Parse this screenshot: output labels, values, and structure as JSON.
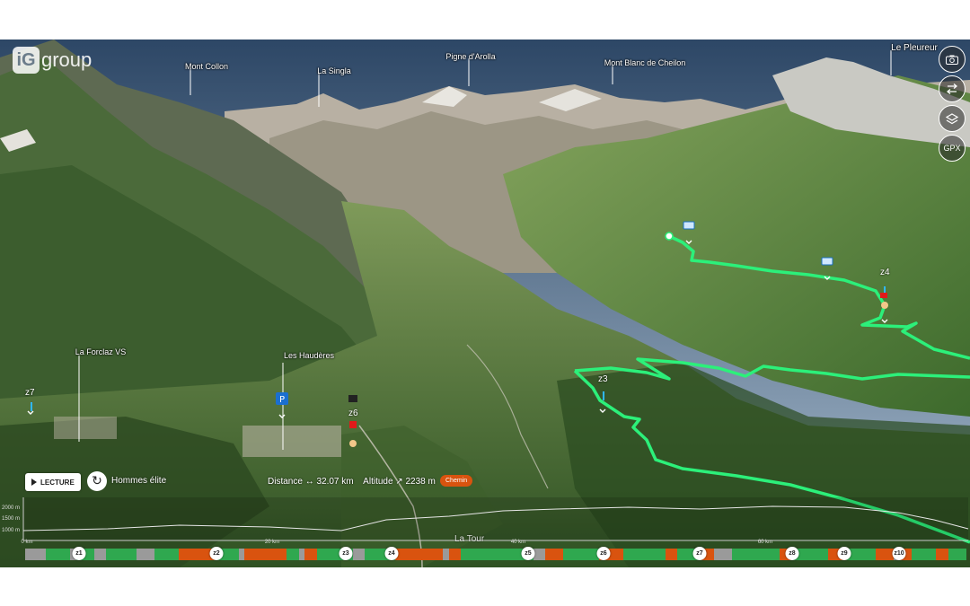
{
  "logo": {
    "mark": "iG",
    "text": "group"
  },
  "peaks": [
    {
      "label": "Mont Collon"
    },
    {
      "label": "La Singla"
    },
    {
      "label": "Pigne d'Arolla"
    },
    {
      "label": "Mont Blanc de Cheilon"
    },
    {
      "label": "Le Pleureur"
    }
  ],
  "places": [
    {
      "label": "La Forclaz VS"
    },
    {
      "label": "Les Haudères"
    }
  ],
  "zones_on_map": [
    "z7",
    "z6",
    "z3",
    "z4"
  ],
  "side_buttons": [
    {
      "name": "camera-icon",
      "text": ""
    },
    {
      "name": "swap-icon",
      "text": ""
    },
    {
      "name": "layers-icon",
      "text": ""
    },
    {
      "name": "gpx",
      "text": "GPX"
    }
  ],
  "player": {
    "lecture_label": "LECTURE",
    "category": "Hommes élite",
    "distance_label": "Distance",
    "distance_icon": "↔",
    "distance_value": "32.07 km",
    "altitude_label": "Altitude",
    "altitude_icon": "↗",
    "altitude_value": "2238 m",
    "surface_badge": "Chemin"
  },
  "profile": {
    "alt_ticks": [
      "2000 m",
      "1500 m",
      "1000 m"
    ],
    "km_ticks": [
      "0 km",
      "20 km",
      "40 km",
      "60 km"
    ],
    "location_label": "La Tour"
  },
  "zonebar": {
    "colors": {
      "grass": "#2fa84f",
      "path": "#d9530f",
      "road": "#9a9a9a"
    },
    "segments": [
      [
        "road",
        3.5
      ],
      [
        "grass",
        4
      ],
      [
        "road",
        1
      ],
      [
        "grass",
        3
      ],
      [
        "road",
        2
      ],
      [
        "grass",
        5
      ],
      [
        "road",
        3
      ],
      [
        "grass",
        4
      ],
      [
        "path",
        6
      ],
      [
        "grass",
        4
      ],
      [
        "road",
        1
      ],
      [
        "path",
        7
      ],
      [
        "grass",
        2
      ],
      [
        "road",
        1
      ],
      [
        "path",
        2
      ],
      [
        "grass",
        6
      ],
      [
        "road",
        2
      ],
      [
        "grass",
        5
      ],
      [
        "path",
        8
      ],
      [
        "road",
        1
      ],
      [
        "path",
        2
      ],
      [
        "grass",
        12
      ],
      [
        "road",
        2
      ],
      [
        "path",
        3
      ],
      [
        "grass",
        6
      ],
      [
        "path",
        4
      ],
      [
        "grass",
        7
      ],
      [
        "path",
        2
      ],
      [
        "grass",
        4
      ],
      [
        "path",
        2
      ],
      [
        "road",
        3
      ],
      [
        "grass",
        8
      ],
      [
        "path",
        2
      ],
      [
        "grass",
        6
      ],
      [
        "path",
        3
      ],
      [
        "grass",
        5
      ],
      [
        "path",
        3
      ],
      [
        "road",
        1
      ],
      [
        "path",
        2
      ],
      [
        "grass",
        4
      ],
      [
        "path",
        2
      ],
      [
        "grass",
        3
      ]
    ],
    "markers": [
      "z1",
      "z2",
      "z3",
      "z4",
      "z5",
      "z6",
      "z7",
      "z8",
      "z9",
      "z10"
    ]
  }
}
